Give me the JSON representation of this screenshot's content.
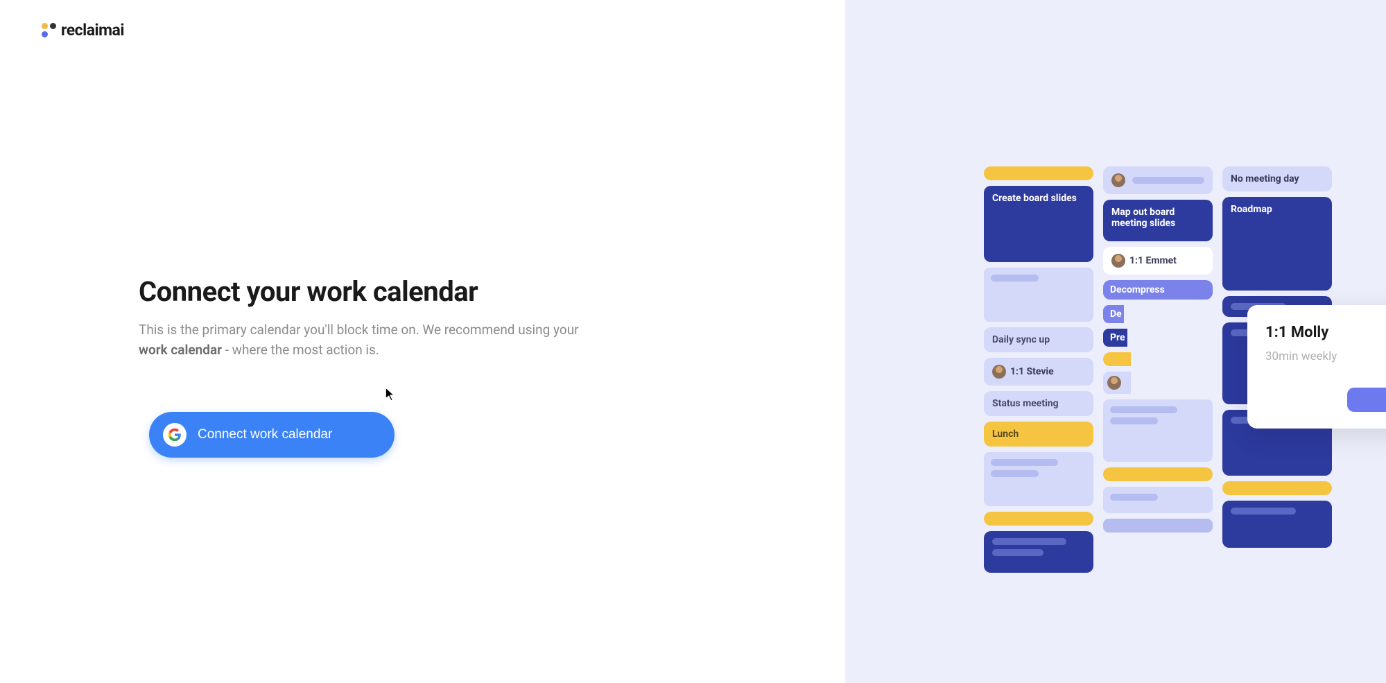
{
  "logo": {
    "text": "reclaimai"
  },
  "main": {
    "heading": "Connect your work calendar",
    "description_prefix": "This is the primary calendar you'll block time on. We recommend using your ",
    "description_bold": "work calendar",
    "description_suffix": " - where the most action is.",
    "button_label": "Connect work calendar"
  },
  "calendar": {
    "col1": {
      "event1": "Create board slides",
      "event2": "Daily sync up",
      "event3": "1:1 Stevie",
      "event4": "Status meeting",
      "event5": "Lunch"
    },
    "col2": {
      "event1": "Map out board meeting slides",
      "event2": "1:1 Emmet",
      "event3": "Decompress",
      "event4_truncated": "De",
      "event5_truncated": "Pre"
    },
    "col3": {
      "event1": "No meeting day",
      "event2": "Roadmap"
    }
  },
  "tooltip": {
    "title": "1:1 Molly",
    "subtitle": "30min weekly"
  }
}
